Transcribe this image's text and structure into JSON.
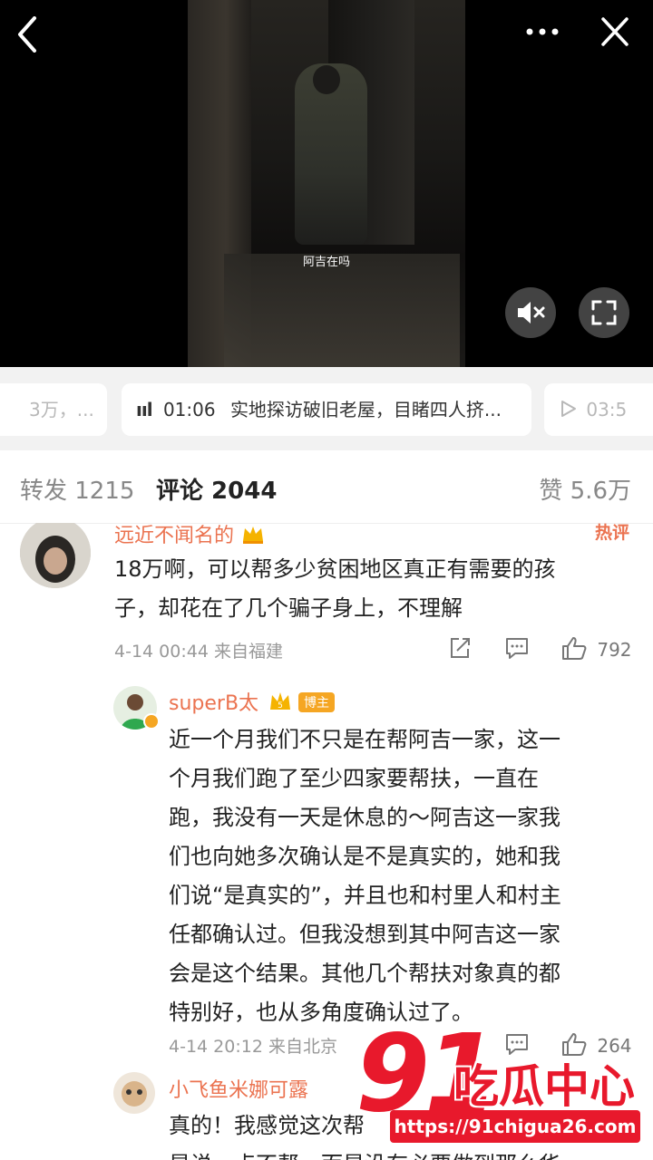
{
  "video": {
    "subtitle": "阿吉在吗"
  },
  "chapters": [
    {
      "label": "3万，..."
    },
    {
      "time": "01:06",
      "title": "实地探访破旧老屋，目睹四人挤..."
    },
    {
      "time": "03:5"
    }
  ],
  "tabs": {
    "repost": "转发 1215",
    "comments": "评论 2044",
    "likes": "赞 5.6万"
  },
  "comments": [
    {
      "username": "远近不闻名的",
      "badge": "热评",
      "text_lines": [
        "18万啊，可以帮多少贫困地区真正有需要的孩",
        "子，却花在了几个骗子身上，不理解"
      ],
      "meta": "4-14 00:44  来自福建",
      "likes": "792"
    },
    {
      "username": "superB太",
      "tag": "博主",
      "text_lines": [
        "近一个月我们不只是在帮阿吉一家，这一",
        "个月我们跑了至少四家要帮扶，一直在",
        "跑，我没有一天是休息的～阿吉这一家我",
        "们也向她多次确认是不是真实的，她和我",
        "们说“是真实的”，并且也和村里人和村主",
        "任都确认过。但我没想到其中阿吉这一家",
        "会是这个结果。其他几个帮扶对象真的都",
        "特别好，也从多角度确认过了。"
      ],
      "meta": "4-14 20:12  来自北京",
      "likes": "264"
    },
    {
      "username": "小飞鱼米娜可露",
      "text_lines": [
        "真的！我感觉这次帮",
        "是说一点不帮，而是没有必要做到那么华"
      ]
    }
  ],
  "watermark": {
    "number": "91",
    "text": "吃瓜中心",
    "url": "https://91chigua26.com"
  },
  "colors": {
    "accent": "#eb7350",
    "vip_gold": "#f5b300",
    "watermark_red": "#e8192c"
  }
}
